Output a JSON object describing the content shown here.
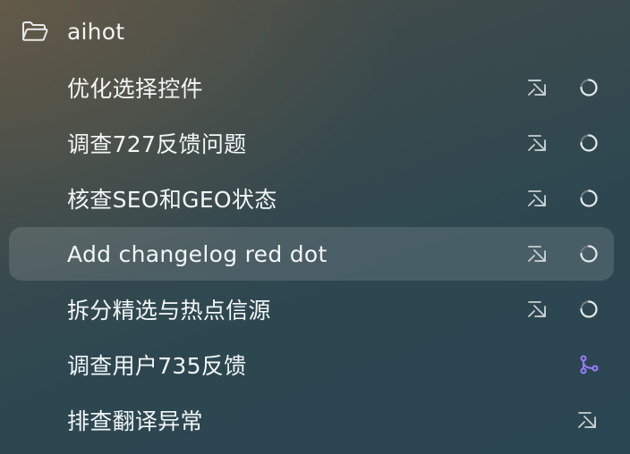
{
  "folder": {
    "name": "aihot",
    "icon": "folder-icon"
  },
  "items": [
    {
      "label": "优化选择控件",
      "open_icon": "open-external-icon",
      "status_icon": "spinner-icon",
      "selected": false
    },
    {
      "label": "调查727反馈问题",
      "open_icon": "open-external-icon",
      "status_icon": "spinner-icon",
      "selected": false
    },
    {
      "label": "核查SEO和GEO状态",
      "open_icon": "open-external-icon",
      "status_icon": "spinner-icon",
      "selected": false
    },
    {
      "label": "Add changelog red dot",
      "open_icon": "open-external-icon",
      "status_icon": "spinner-icon",
      "selected": true
    },
    {
      "label": "拆分精选与热点信源",
      "open_icon": "open-external-icon",
      "status_icon": "spinner-icon",
      "selected": false
    },
    {
      "label": "调查用户735反馈",
      "status_icon": "git-branch-icon",
      "selected": false
    },
    {
      "label": "排查翻译异常",
      "open_icon": "open-external-icon",
      "selected": false
    }
  ],
  "colors": {
    "branch_accent": "#9b7bff",
    "icon_gray": "#c9cfd0",
    "selected_bg": "rgba(255,255,255,0.13)"
  }
}
